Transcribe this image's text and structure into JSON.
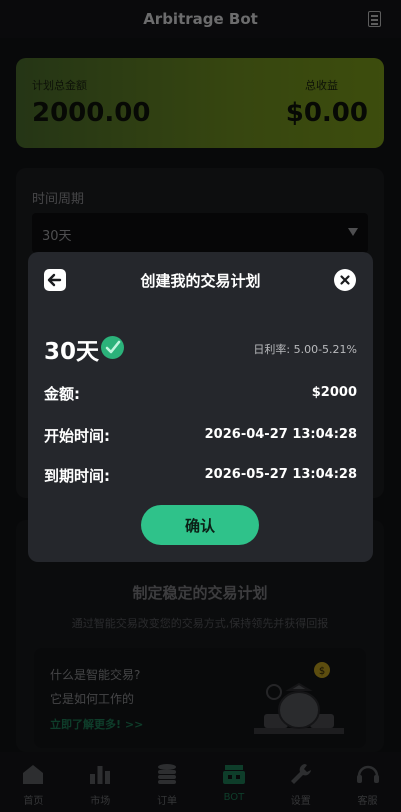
{
  "header": {
    "title": "Arbitrage Bot",
    "icon": "document-icon"
  },
  "summary": {
    "plan_total_label": "计划总金额",
    "plan_total_value": "2000.00",
    "total_profit_label": "总收益",
    "total_profit_value": "$0.00"
  },
  "period_card": {
    "label": "时间周期",
    "selected": "30天"
  },
  "info_card": {
    "heading": "制定稳定的交易计划",
    "subheading": "通过智能交易改变您的交易方式,保持领先并获得回报",
    "promo_q1": "什么是智能交易?",
    "promo_q2": "它是如何工作的",
    "promo_link": "立即了解更多! >>"
  },
  "modal": {
    "title": "创建我的交易计划",
    "period": "30天",
    "rate_label": "日利率:",
    "rate_value": "5.00-5.21%",
    "amount_label": "金额:",
    "amount_value": "$2000",
    "start_label": "开始时间:",
    "start_value": "2026-04-27 13:04:28",
    "end_label": "到期时间:",
    "end_value": "2026-05-27 13:04:28",
    "confirm_label": "确认"
  },
  "tabs": [
    {
      "label": "首页",
      "icon": "home-icon"
    },
    {
      "label": "市场",
      "icon": "bar-chart-icon"
    },
    {
      "label": "订单",
      "icon": "coins-stack-icon"
    },
    {
      "label": "BOT",
      "icon": "bot-icon"
    },
    {
      "label": "设置",
      "icon": "wrench-icon"
    },
    {
      "label": "客服",
      "icon": "headset-icon"
    }
  ],
  "active_tab": "BOT",
  "colors": {
    "accent": "#2fc28a",
    "summary_start": "#4a6b2c",
    "summary_end": "#7a9a1a"
  }
}
